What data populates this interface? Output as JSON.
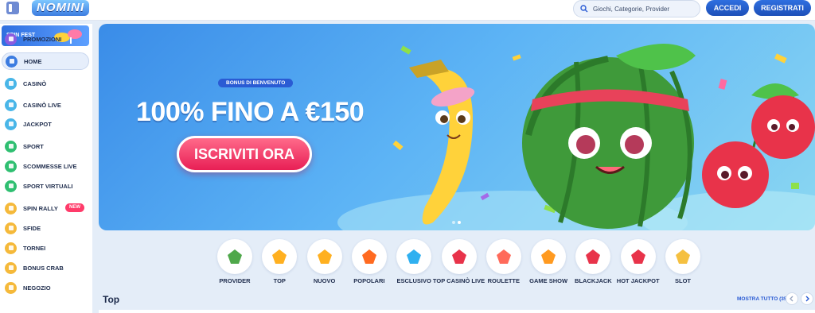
{
  "header": {
    "logo_text": "NOMINI",
    "search_placeholder": "Giochi, Categorie, Provider",
    "login_label": "ACCEDI",
    "register_label": "REGISTRATI"
  },
  "sidebar": {
    "promo_banner_label": "SPIN FEST",
    "items": [
      {
        "label": "PROMOZIONI",
        "icon": "gift-icon",
        "color": "#8a5ce0"
      },
      {
        "label": "HOME",
        "icon": "home-icon",
        "color": "#3c7ce0",
        "active": true
      },
      {
        "label": "CASINÒ",
        "icon": "casino-icon",
        "color": "#49b6e8"
      },
      {
        "label": "CASINÒ LIVE",
        "icon": "live-casino-icon",
        "color": "#49b6e8"
      },
      {
        "label": "JACKPOT",
        "icon": "jackpot-icon",
        "color": "#49b6e8"
      },
      {
        "label": "SPORT",
        "icon": "sport-icon",
        "color": "#2fbf71"
      },
      {
        "label": "SCOMMESSE LIVE",
        "icon": "live-bet-icon",
        "color": "#2fbf71"
      },
      {
        "label": "SPORT VIRTUALI",
        "icon": "virtual-sport-icon",
        "color": "#2fbf71"
      },
      {
        "label": "SPIN RALLY",
        "icon": "spin-rally-icon",
        "color": "#f5b93a",
        "badge": "NEW"
      },
      {
        "label": "SFIDE",
        "icon": "challenges-icon",
        "color": "#f5b93a"
      },
      {
        "label": "TORNEI",
        "icon": "tournaments-icon",
        "color": "#f5b93a"
      },
      {
        "label": "BONUS CRAB",
        "icon": "bonus-crab-icon",
        "color": "#f5b93a"
      },
      {
        "label": "NEGOZIO",
        "icon": "shop-icon",
        "color": "#f5b93a"
      }
    ]
  },
  "hero": {
    "bonus_pill": "BONUS DI BENVENUTO",
    "title": "100% FINO A €150",
    "cta_label": "ISCRIVITI ORA",
    "slides_total": 2,
    "active_slide": 2
  },
  "categories": [
    {
      "label": "PROVIDER",
      "icon": "provider-icon"
    },
    {
      "label": "TOP",
      "icon": "crown-icon"
    },
    {
      "label": "NUOVO",
      "icon": "lightning-icon"
    },
    {
      "label": "POPOLARI",
      "icon": "flame-icon"
    },
    {
      "label": "ESCLUSIVO",
      "icon": "diamond-icon"
    },
    {
      "label": "TOP CASINÒ LIVE",
      "icon": "roulette-chip-icon"
    },
    {
      "label": "ROULETTE",
      "icon": "roulette-icon"
    },
    {
      "label": "GAME SHOW",
      "icon": "game-show-icon"
    },
    {
      "label": "BLACKJACK",
      "icon": "cards-icon"
    },
    {
      "label": "HOT JACKPOT",
      "icon": "hot-pepper-icon"
    },
    {
      "label": "SLOT",
      "icon": "slot-icon"
    }
  ],
  "top_section": {
    "title": "Top",
    "show_all_label": "MOSTRA TUTTO (350)"
  },
  "colors": {
    "brand_blue": "#2a5bd4",
    "cta_pink": "#e81f55"
  }
}
